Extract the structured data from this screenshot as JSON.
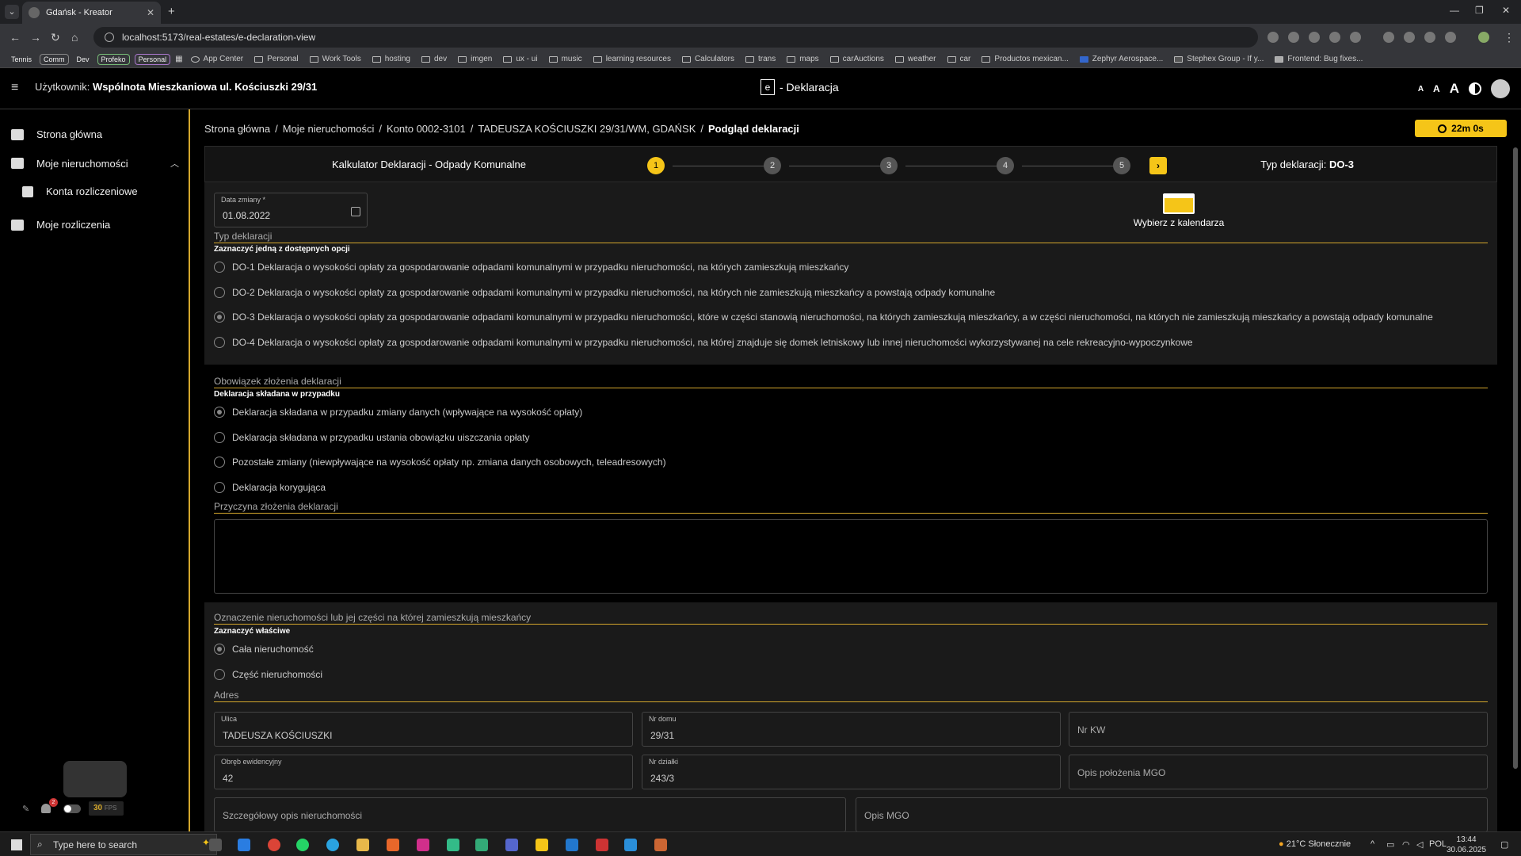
{
  "browser": {
    "tab_title": "Gdańsk - Kreator",
    "tab_close": "✕",
    "new_tab": "+",
    "url": "localhost:5173/real-estates/e-declaration-view",
    "bookmark_pills": [
      "Tennis",
      "Comm",
      "Dev",
      "Profeko",
      "Personal"
    ],
    "bookmarks": [
      "App Center",
      "Personal",
      "Work Tools",
      "hosting",
      "dev",
      "imgen",
      "ux - ui",
      "music",
      "learning resources",
      "Calculators",
      "trans",
      "maps",
      "carAuctions",
      "weather",
      "car",
      "Productos mexican...",
      "Zephyr Aerospace...",
      "Stephex Group - If y...",
      "Frontend: Bug fixes..."
    ]
  },
  "header": {
    "user_prefix": "Użytkownik:",
    "user_name": "Wspólnota Mieszkaniowa ul. Kościuszki 29/31",
    "logo_letter": "e",
    "title": "- Deklaracja",
    "font_small": "A",
    "font_medium": "A",
    "font_large": "A"
  },
  "sidebar": {
    "items": [
      {
        "label": "Strona główna"
      },
      {
        "label": "Moje nieruchomości"
      },
      {
        "label": "Konta rozliczeniowe"
      },
      {
        "label": "Moje rozliczenia"
      }
    ],
    "fps_value": "30",
    "fps_unit": "FPS",
    "notification_count": "2"
  },
  "breadcrumb": {
    "items": [
      "Strona główna",
      "Moje nieruchomości",
      "Konto 0002-3101",
      "TADEUSZA KOŚCIUSZKI 29/31/WM, GDAŃSK"
    ],
    "current": "Podgląd deklaracji",
    "separator": "/"
  },
  "timer": "22m 0s",
  "stepper": {
    "title": "Kalkulator Deklaracji - Odpady Komunalne",
    "steps": [
      "1",
      "2",
      "3",
      "4",
      "5"
    ],
    "active_step": 1,
    "next": "›",
    "decl_type_label": "Typ deklaracji:",
    "decl_type_value": "DO-3"
  },
  "date_field": {
    "label": "Data zmiany *",
    "value": "01.08.2022"
  },
  "calendar_pick": "Wybierz z kalendarza",
  "section_type": {
    "title": "Typ deklaracji",
    "subtitle": "Zaznaczyć jedną z dostępnych opcji",
    "options": [
      {
        "label": "DO-1 Deklaracja o wysokości opłaty za gospodarowanie odpadami komunalnymi w przypadku nieruchomości, na których zamieszkują mieszkańcy",
        "selected": false
      },
      {
        "label": "DO-2 Deklaracja o wysokości opłaty za gospodarowanie odpadami komunalnymi w przypadku nieruchomości, na których nie zamieszkują mieszkańcy a powstają odpady komunalne",
        "selected": false
      },
      {
        "label": "DO-3 Deklaracja o wysokości opłaty za gospodarowanie odpadami komunalnymi w przypadku nieruchomości, które w części stanowią nieruchomości, na których zamieszkują mieszkańcy, a w części nieruchomości, na których nie zamieszkują mieszkańcy a powstają odpady komunalne",
        "selected": true
      },
      {
        "label": "DO-4 Deklaracja o wysokości opłaty za gospodarowanie odpadami komunalnymi w przypadku nieruchomości, na której znajduje się domek letniskowy lub innej nieruchomości wykorzystywanej na cele rekreacyjno-wypoczynkowe",
        "selected": false
      }
    ]
  },
  "section_obligation": {
    "title": "Obowiązek złożenia deklaracji",
    "subtitle": "Deklaracja składana w przypadku",
    "options": [
      {
        "label": "Deklaracja składana w przypadku zmiany danych (wpływające na wysokość opłaty)",
        "selected": true
      },
      {
        "label": "Deklaracja składana w przypadku ustania obowiązku uiszczania opłaty",
        "selected": false
      },
      {
        "label": "Pozostałe zmiany (niewpływające na wysokość opłaty np. zmiana danych osobowych, teleadresowych)",
        "selected": false
      },
      {
        "label": "Deklaracja korygująca",
        "selected": false
      }
    ],
    "reason_title": "Przyczyna złożenia deklaracji"
  },
  "section_property": {
    "title": "Oznaczenie nieruchomości lub jej części na której zamieszkują mieszkańcy",
    "subtitle": "Zaznaczyć właściwe",
    "options": [
      {
        "label": "Cała nieruchomość",
        "selected": true
      },
      {
        "label": "Część nieruchomości",
        "selected": false
      }
    ],
    "address_title": "Adres",
    "street_label": "Ulica",
    "street_value": "TADEUSZA KOŚCIUSZKI",
    "house_label": "Nr domu",
    "house_value": "29/31",
    "kw_placeholder": "Nr KW",
    "precinct_label": "Obręb ewidencyjny",
    "precinct_value": "42",
    "plot_label": "Nr działki",
    "plot_value": "243/3",
    "mgo_location_placeholder": "Opis położenia MGO",
    "detail_placeholder": "Szczegółowy opis nieruchomości",
    "mgo_placeholder": "Opis MGO"
  },
  "taskbar": {
    "search_placeholder": "Type here to search",
    "weather": "21°C Słonecznie",
    "lang": "POL",
    "time": "13:44",
    "date": "30.06.2025"
  }
}
